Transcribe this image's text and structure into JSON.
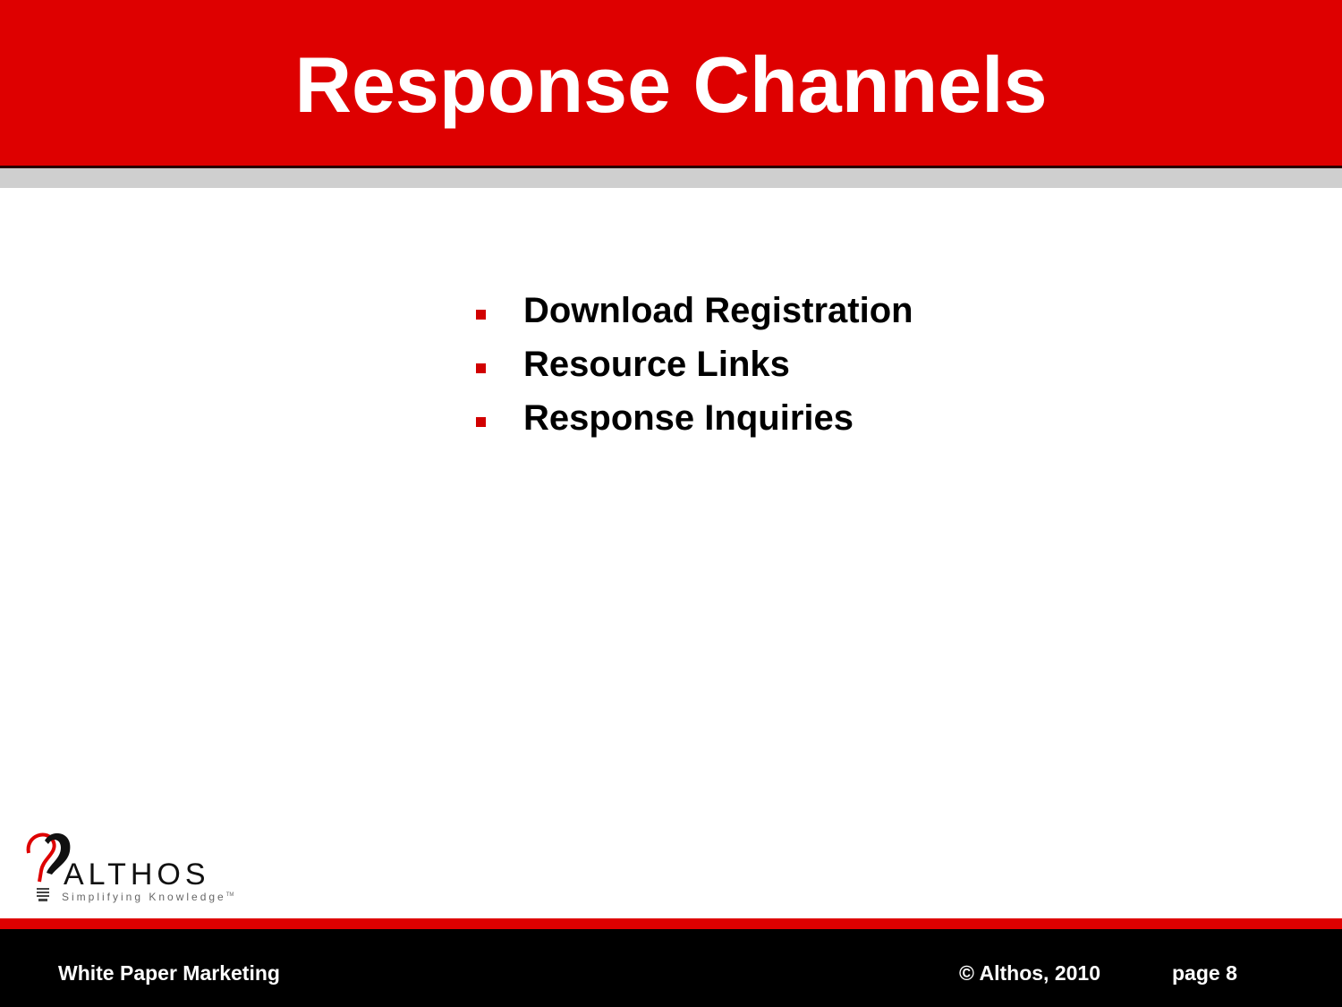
{
  "slide": {
    "title": "Response Channels",
    "bullets": [
      "Download Registration",
      "Resource Links",
      "Response Inquiries"
    ]
  },
  "logo": {
    "name": "ALTHOS",
    "tagline": "Simplifying Knowledge",
    "trademark": "TM"
  },
  "footer": {
    "left": "White Paper Marketing",
    "copyright": "© Althos,  2010",
    "page": "page 8"
  },
  "colors": {
    "accent_red": "#de0000",
    "footer_bg": "#000000",
    "shadow_gray": "#cfcfcf"
  },
  "icons": {
    "logo": "lightbulb-question-mark-icon",
    "bullet": "square-bullet"
  }
}
